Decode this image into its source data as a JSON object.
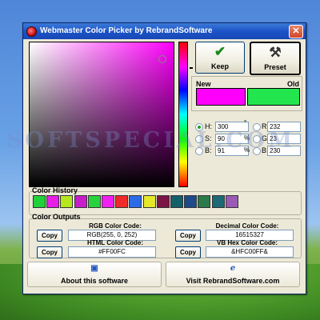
{
  "window": {
    "title": "Webmaster Color Picker by RebrandSoftware",
    "close_glyph": "✕"
  },
  "buttons": {
    "keep": {
      "label": "Keep",
      "icon": "check-icon",
      "glyph": "✔"
    },
    "preset": {
      "label": "Preset",
      "icon": "tools-icon",
      "glyph": "⚒"
    }
  },
  "swatches": {
    "new_label": "New",
    "old_label": "Old",
    "new_color": "#ff00fc",
    "old_color": "#23e64f"
  },
  "hsb": {
    "h": {
      "label": "H:",
      "value": "300",
      "unit": "°"
    },
    "s": {
      "label": "S:",
      "value": "90",
      "unit": "%"
    },
    "b": {
      "label": "B:",
      "value": "91",
      "unit": "%"
    }
  },
  "rgb": {
    "r": {
      "label": "R:",
      "value": "232"
    },
    "g": {
      "label": "G:",
      "value": "23"
    },
    "b": {
      "label": "B:",
      "value": "230"
    }
  },
  "history": {
    "title": "Color History",
    "colors": [
      "#21d13a",
      "#e81ee8",
      "#b5e61e",
      "#c71ec9",
      "#28d23c",
      "#f020f0",
      "#ee2a2a",
      "#2b6be8",
      "#e5e82a",
      "#7a1545",
      "#12616a",
      "#1f4a8a",
      "#2a7a4a",
      "#1b6a75",
      "#9a5ab5"
    ]
  },
  "outputs": {
    "title": "Color Outputs",
    "rgb_label": "RGB Color Code:",
    "rgb_value": "RGB(255, 0, 252)",
    "html_label": "HTML Color Code:",
    "html_value": "#FF00FC",
    "decimal_label": "Decimal Color Code:",
    "decimal_value": "16515327",
    "vb_label": "VB Hex Color Code:",
    "vb_value": "&HFC00FF&",
    "copy_label": "Copy"
  },
  "footer": {
    "about_label": "About this software",
    "about_icon": "info-window-icon",
    "about_glyph": "▣",
    "visit_label": "Visit RebrandSoftware.com",
    "visit_icon": "internet-explorer-icon",
    "visit_glyph": "e"
  },
  "watermark": "SOFTSPECIAL.COM"
}
